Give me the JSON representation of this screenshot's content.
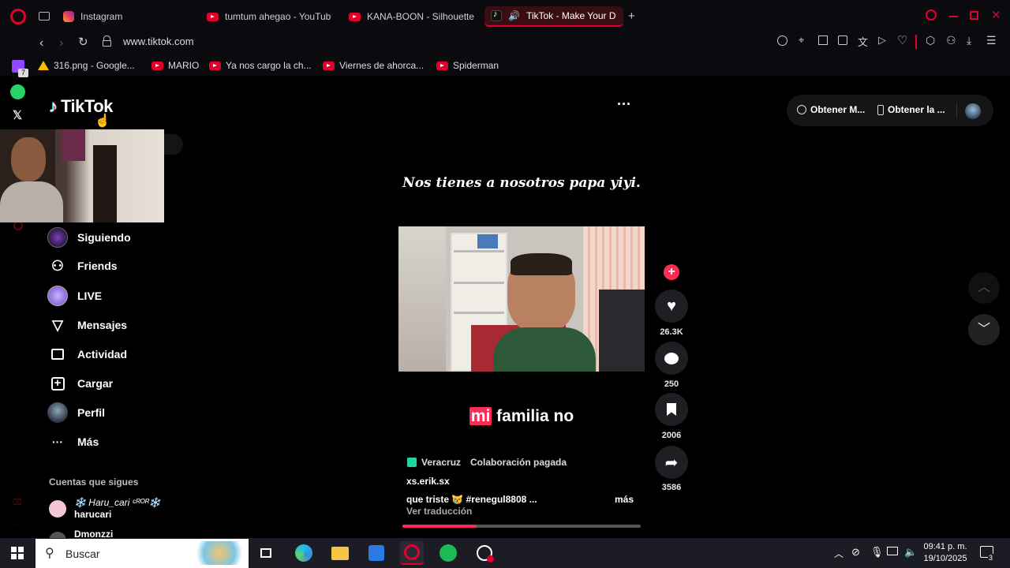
{
  "browser": {
    "tabs": [
      {
        "label": "Instagram",
        "icon": "instagram-icon"
      },
      {
        "label": "tumtum ahegao - YouTub",
        "icon": "youtube-icon"
      },
      {
        "label": "KANA-BOON - Silhouette",
        "icon": "youtube-icon"
      },
      {
        "label": "TikTok - Make Your D",
        "icon": "tiktok-icon",
        "active": true
      }
    ],
    "new_tab": "+",
    "url": "www.tiktok.com",
    "bookmarks": [
      {
        "label": "316.png - Google...",
        "icon": "google-drive-icon"
      },
      {
        "label": "MARIO",
        "icon": "youtube-icon"
      },
      {
        "label": "Ya nos cargo la ch...",
        "icon": "youtube-icon"
      },
      {
        "label": "Viernes de ahorca...",
        "icon": "youtube-icon"
      },
      {
        "label": "Spiderman",
        "icon": "youtube-icon"
      }
    ],
    "twitch_badge": "7"
  },
  "tiktok": {
    "logo_text": "TikTok",
    "more_options": "···",
    "top_right": {
      "coins_label": "Obtener M...",
      "app_label": "Obtener la ..."
    },
    "nav": [
      {
        "label": "Siguiendo",
        "icon": "following-avatar-icon"
      },
      {
        "label": "Friends",
        "icon": "friends-icon"
      },
      {
        "label": "LIVE",
        "icon": "live-icon"
      },
      {
        "label": "Mensajes",
        "icon": "messages-icon"
      },
      {
        "label": "Actividad",
        "icon": "activity-icon"
      },
      {
        "label": "Cargar",
        "icon": "upload-icon"
      },
      {
        "label": "Perfil",
        "icon": "profile-avatar-icon"
      },
      {
        "label": "Más",
        "icon": "more-icon"
      }
    ],
    "following_heading": "Cuentas que sigues",
    "following": [
      {
        "display": "❄️ Haru_cari ᶜᴿᴼᴿ❄️",
        "username": "harucari"
      },
      {
        "display": "",
        "username": "Dmonzzi"
      }
    ],
    "video": {
      "caption_top": "Nos tienes a nosotros papa yiyi.",
      "caption_bottom_highlight": "mi",
      "caption_bottom_rest": "familia no",
      "location": "Veracruz",
      "paid": "Colaboración pagada",
      "author": "xs.erik.sx",
      "description": "que triste 😿 #renegul8808  ...",
      "more": "más",
      "translate": "Ver traducción",
      "progress": 0.31
    },
    "actions": {
      "likes": "26.3K",
      "comments": "250",
      "saves": "2006",
      "shares": "3586"
    }
  },
  "taskbar": {
    "search_placeholder": "Buscar",
    "time": "09:41 p. m.",
    "date": "19/10/2025",
    "notification_count": "3"
  },
  "colors": {
    "accent": "#fe2c55",
    "opera_red": "#e4002b"
  }
}
